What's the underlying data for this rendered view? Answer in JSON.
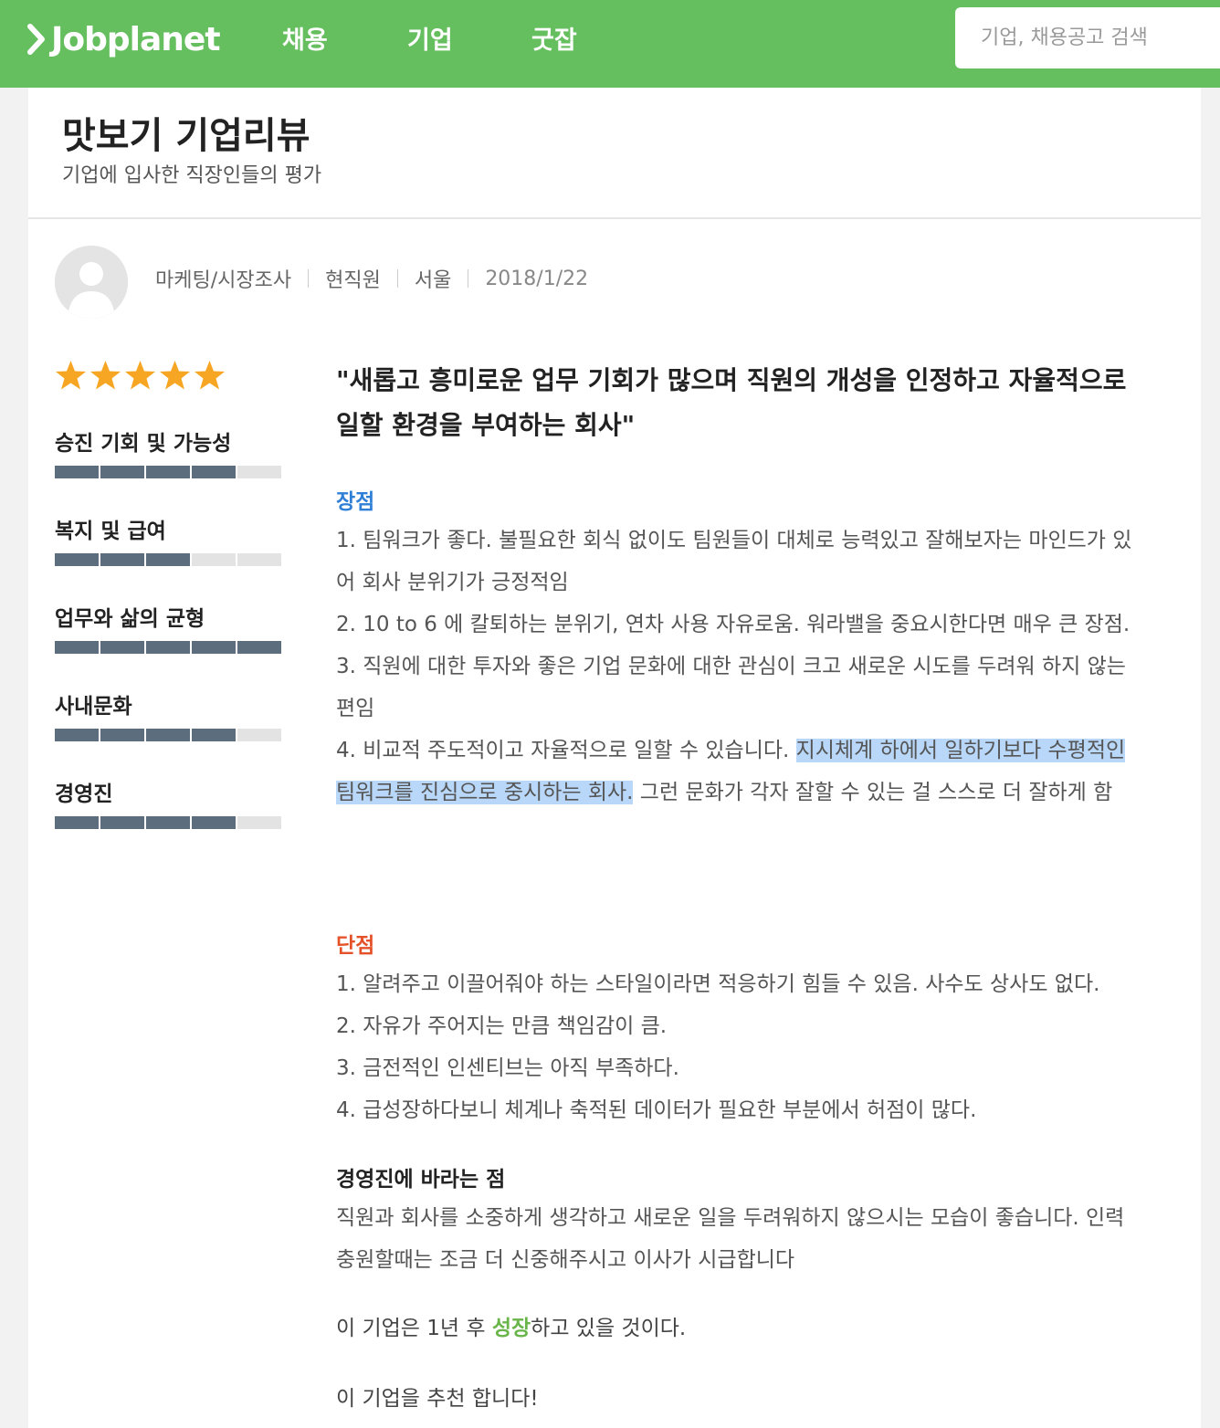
{
  "header": {
    "logo_text": "Jobplanet",
    "nav": [
      "채용",
      "기업",
      "굿잡"
    ],
    "search_placeholder": "기업, 채용공고 검색",
    "brand_color": "#66bf5f"
  },
  "page": {
    "title": "맛보기 기업리뷰",
    "subtitle": "기업에 입사한 직장인들의 평가"
  },
  "review": {
    "author": {
      "job": "마케팅/시장조사",
      "status": "현직원",
      "location": "서울",
      "date": "2018/1/22"
    },
    "overall_stars": 5,
    "ratings": [
      {
        "label": "승진 기회 및 가능성",
        "value": 4,
        "max": 5
      },
      {
        "label": "복지 및 급여",
        "value": 3,
        "max": 5
      },
      {
        "label": "업무와 삶의 균형",
        "value": 5,
        "max": 5
      },
      {
        "label": "사내문화",
        "value": 4,
        "max": 5
      },
      {
        "label": "경영진",
        "value": 4,
        "max": 5
      }
    ],
    "title": "\"새롭고 흥미로운 업무 기회가 많으며 직원의 개성을 인정하고 자율적으로 일할 환경을 부여하는 회사\"",
    "pros_label": "장점",
    "pros": {
      "p1": "1. 팀워크가 좋다. 불필요한 회식 없이도 팀원들이 대체로 능력있고 잘해보자는 마인드가 있어 회사 분위기가 긍정적임",
      "p2": "2. 10 to 6 에 칼퇴하는 분위기, 연차 사용 자유로움. 워라밸을 중요시한다면 매우 큰 장점.",
      "p3": "3. 직원에 대한 투자와 좋은 기업 문화에 대한 관심이 크고 새로운 시도를 두려워 하지 않는 편임",
      "p4_before": "4. 비교적 주도적이고 자율적으로 일할 수 있습니다. ",
      "p4_highlight": "지시체계 하에서 일하기보다 수평적인 팀워크를 진심으로 중시하는 회사.",
      "p4_after": " 그런 문화가 각자 잘할 수 있는 걸 스스로 더 잘하게 함"
    },
    "cons_label": "단점",
    "cons": [
      "1. 알려주고 이끌어줘야 하는 스타일이라면 적응하기 힘들 수 있음. 사수도 상사도 없다.",
      "2. 자유가 주어지는 만큼 책임감이 큼.",
      "3. 금전적인 인센티브는 아직 부족하다.",
      "4. 급성장하다보니 체계나 축적된 데이터가 필요한 부분에서 허점이 많다."
    ],
    "wish_label": "경영진에 바라는 점",
    "wish_text": "직원과 회사를 소중하게 생각하고 새로운 일을 두려워하지 않으시는 모습이 좋습니다. 인력 충원할때는 조금 더 신중해주시고 이사가 시급합니다",
    "forecast_prefix": "이 기업은 1년 후 ",
    "forecast_keyword": "성장",
    "forecast_suffix": "하고 있을 것이다.",
    "recommend": "이 기업을 추천 합니다!"
  }
}
